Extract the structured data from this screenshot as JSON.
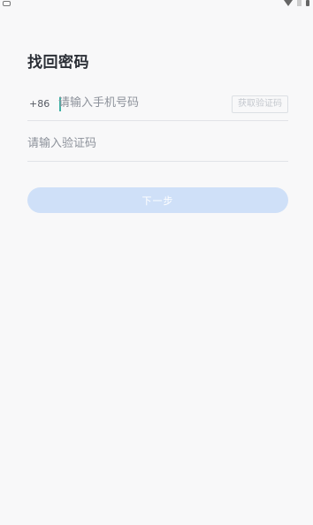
{
  "page": {
    "title": "找回密码"
  },
  "phone": {
    "country_code": "+86",
    "placeholder": "请输入手机号码",
    "value": "",
    "get_code_label": "获取验证码"
  },
  "code": {
    "placeholder": "请输入验证码",
    "value": ""
  },
  "actions": {
    "next_label": "下一步"
  },
  "colors": {
    "primary_button_disabled": "#cfe0f8",
    "caret": "#3fb1a4",
    "background": "#f8f8f9"
  }
}
